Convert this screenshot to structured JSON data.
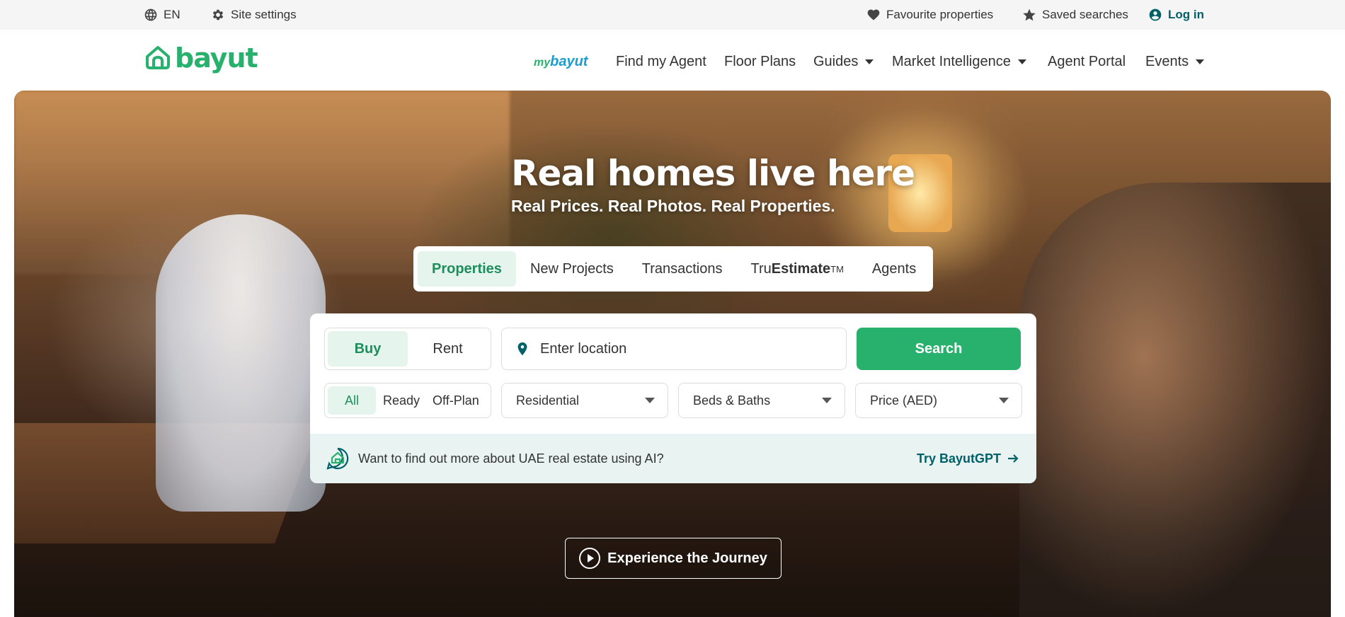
{
  "topbar": {
    "language": "EN",
    "site_settings": "Site settings",
    "favourites": "Favourite properties",
    "saved_searches": "Saved searches",
    "login": "Log in"
  },
  "header": {
    "logo_text": "bayut",
    "mybayut_my": "my",
    "mybayut_brand": "bayut",
    "nav": [
      {
        "label": "Find my Agent",
        "dropdown": false
      },
      {
        "label": "Floor Plans",
        "dropdown": false
      },
      {
        "label": "Guides",
        "dropdown": true
      },
      {
        "label": "Market Intelligence",
        "dropdown": true
      },
      {
        "label": "Agent Portal",
        "dropdown": false
      },
      {
        "label": "Events",
        "dropdown": true
      }
    ]
  },
  "hero": {
    "title": "Real homes live here",
    "subtitle": "Real Prices. Real Photos. Real Properties.",
    "tabs": [
      {
        "label": "Properties",
        "active": true
      },
      {
        "label": "New Projects",
        "active": false
      },
      {
        "label": "Transactions",
        "active": false
      },
      {
        "label_prefix": "Tru",
        "label_bold": "Estimate",
        "label_tm": "TM",
        "active": false
      },
      {
        "label": "Agents",
        "active": false
      }
    ],
    "purpose": {
      "options": [
        "Buy",
        "Rent"
      ],
      "selected": "Buy"
    },
    "location_placeholder": "Enter location",
    "search_label": "Search",
    "completion": {
      "options": [
        "All",
        "Ready",
        "Off-Plan"
      ],
      "selected": "All"
    },
    "dropdowns": {
      "property_type": "Residential",
      "beds_baths": "Beds & Baths",
      "price": "Price (AED)"
    },
    "ai_prompt": "Want to find out more about UAE real estate using AI?",
    "ai_link": "Try BayutGPT",
    "journey_button": "Experience the Journey"
  },
  "colors": {
    "brand_green": "#28b16d",
    "brand_teal": "#006169",
    "active_tab_bg": "#e6f4ee"
  },
  "icons": [
    "globe-icon",
    "gear-icon",
    "heart-icon",
    "star-icon",
    "user-circle-icon",
    "location-pin-icon",
    "bayutgpt-icon",
    "arrow-right-icon",
    "play-icon"
  ]
}
